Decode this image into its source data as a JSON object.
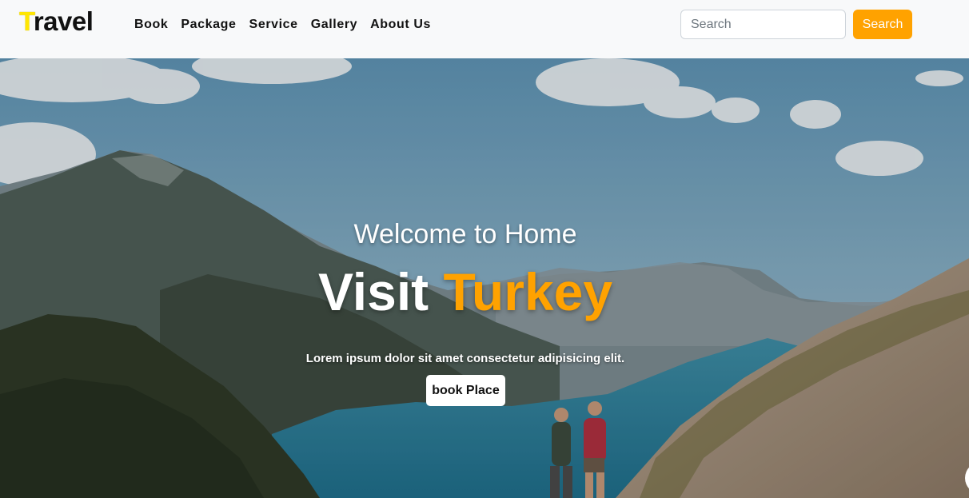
{
  "brand": {
    "first_letter": "T",
    "rest": "ravel"
  },
  "nav": {
    "items": [
      {
        "label": "Book"
      },
      {
        "label": "Package"
      },
      {
        "label": "Service"
      },
      {
        "label": "Gallery"
      },
      {
        "label": "About Us"
      }
    ]
  },
  "search": {
    "placeholder": "Search",
    "value": "",
    "button_label": "Search"
  },
  "hero": {
    "subtitle": "Welcome to Home",
    "title_main": "Visit",
    "title_accent": "Turkey",
    "text": "Lorem ipsum dolor sit amet consectetur adipisicing elit.",
    "button_label": "book Place"
  },
  "colors": {
    "accent": "#ffa200",
    "brand_letter": "#ffe600",
    "navbar_bg": "#f8f9fa"
  }
}
